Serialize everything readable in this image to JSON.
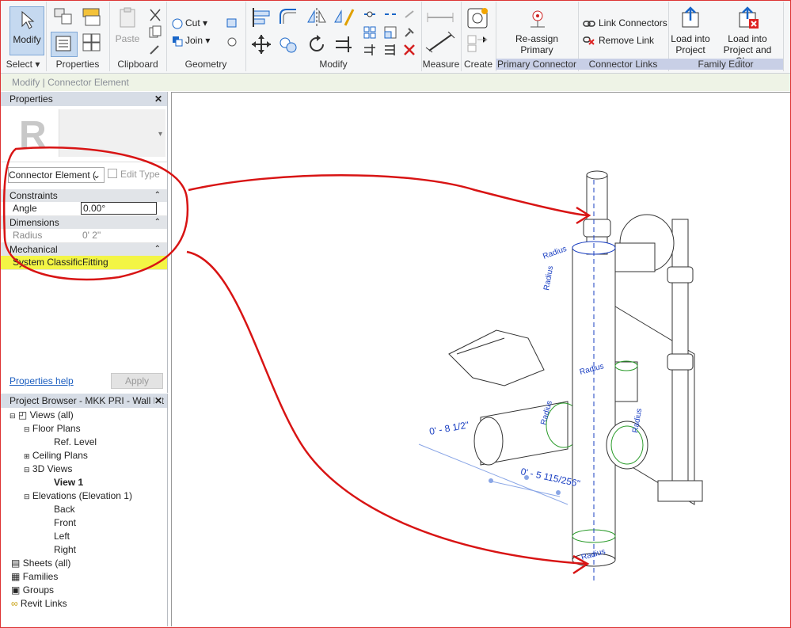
{
  "ribbon": {
    "modify": {
      "label": "Modify"
    },
    "select": {
      "label": "Select ▾"
    },
    "properties": {
      "label": "Properties"
    },
    "clipboard": {
      "label": "Clipboard",
      "paste": "Paste"
    },
    "geometry": {
      "label": "Geometry",
      "cut": "Cut",
      "join": "Join"
    },
    "modify_panel": {
      "label": "Modify"
    },
    "measure": {
      "label": "Measure"
    },
    "create": {
      "label": "Create"
    },
    "primary_connector": {
      "label": "Primary Connector",
      "reassign_line1": "Re-assign",
      "reassign_line2": "Primary"
    },
    "connector_links": {
      "label": "Connector Links",
      "link": "Link Connectors",
      "remove": "Remove Link"
    },
    "family_editor": {
      "label": "Family Editor",
      "load_line1": "Load into",
      "load_line2": "Project",
      "loadclose_line1": "Load into",
      "loadclose_line2": "Project and Close"
    }
  },
  "status_bar": {
    "text": "Modify | Connector Element"
  },
  "properties": {
    "title": "Properties",
    "type_selector": "Connector Element (",
    "edit_type": "Edit Type",
    "groups": [
      {
        "name": "Constraints",
        "rows": [
          {
            "key": "Angle",
            "value": "0.00°"
          }
        ]
      },
      {
        "name": "Dimensions",
        "rows": [
          {
            "key": "Radius",
            "value": "0'  2\""
          }
        ]
      },
      {
        "name": "Mechanical",
        "rows": [
          {
            "key": "System Classific...",
            "value": "Fitting"
          }
        ]
      }
    ],
    "help_link": "Properties help",
    "apply": "Apply"
  },
  "project_browser": {
    "title": "Project Browser - MKK PRI - Wall Mt ...",
    "items": [
      {
        "label": "Views (all)"
      },
      {
        "label": "Floor Plans"
      },
      {
        "label": "Ref. Level"
      },
      {
        "label": "Ceiling Plans"
      },
      {
        "label": "3D Views"
      },
      {
        "label": "View 1"
      },
      {
        "label": "Elevations (Elevation 1)"
      },
      {
        "label": "Back"
      },
      {
        "label": "Front"
      },
      {
        "label": "Left"
      },
      {
        "label": "Right"
      },
      {
        "label": "Sheets (all)"
      },
      {
        "label": "Families"
      },
      {
        "label": "Groups"
      },
      {
        "label": "Revit Links"
      }
    ]
  },
  "viewport": {
    "dim1": "0' - 8 1/2\"",
    "dim2": "0' - 5 115/256\"",
    "radius_label": "Radius"
  },
  "colors": {
    "annotation_red": "#d81414",
    "highlight_yellow": "#f3f545",
    "accent_blue": "#1a3fc2"
  }
}
